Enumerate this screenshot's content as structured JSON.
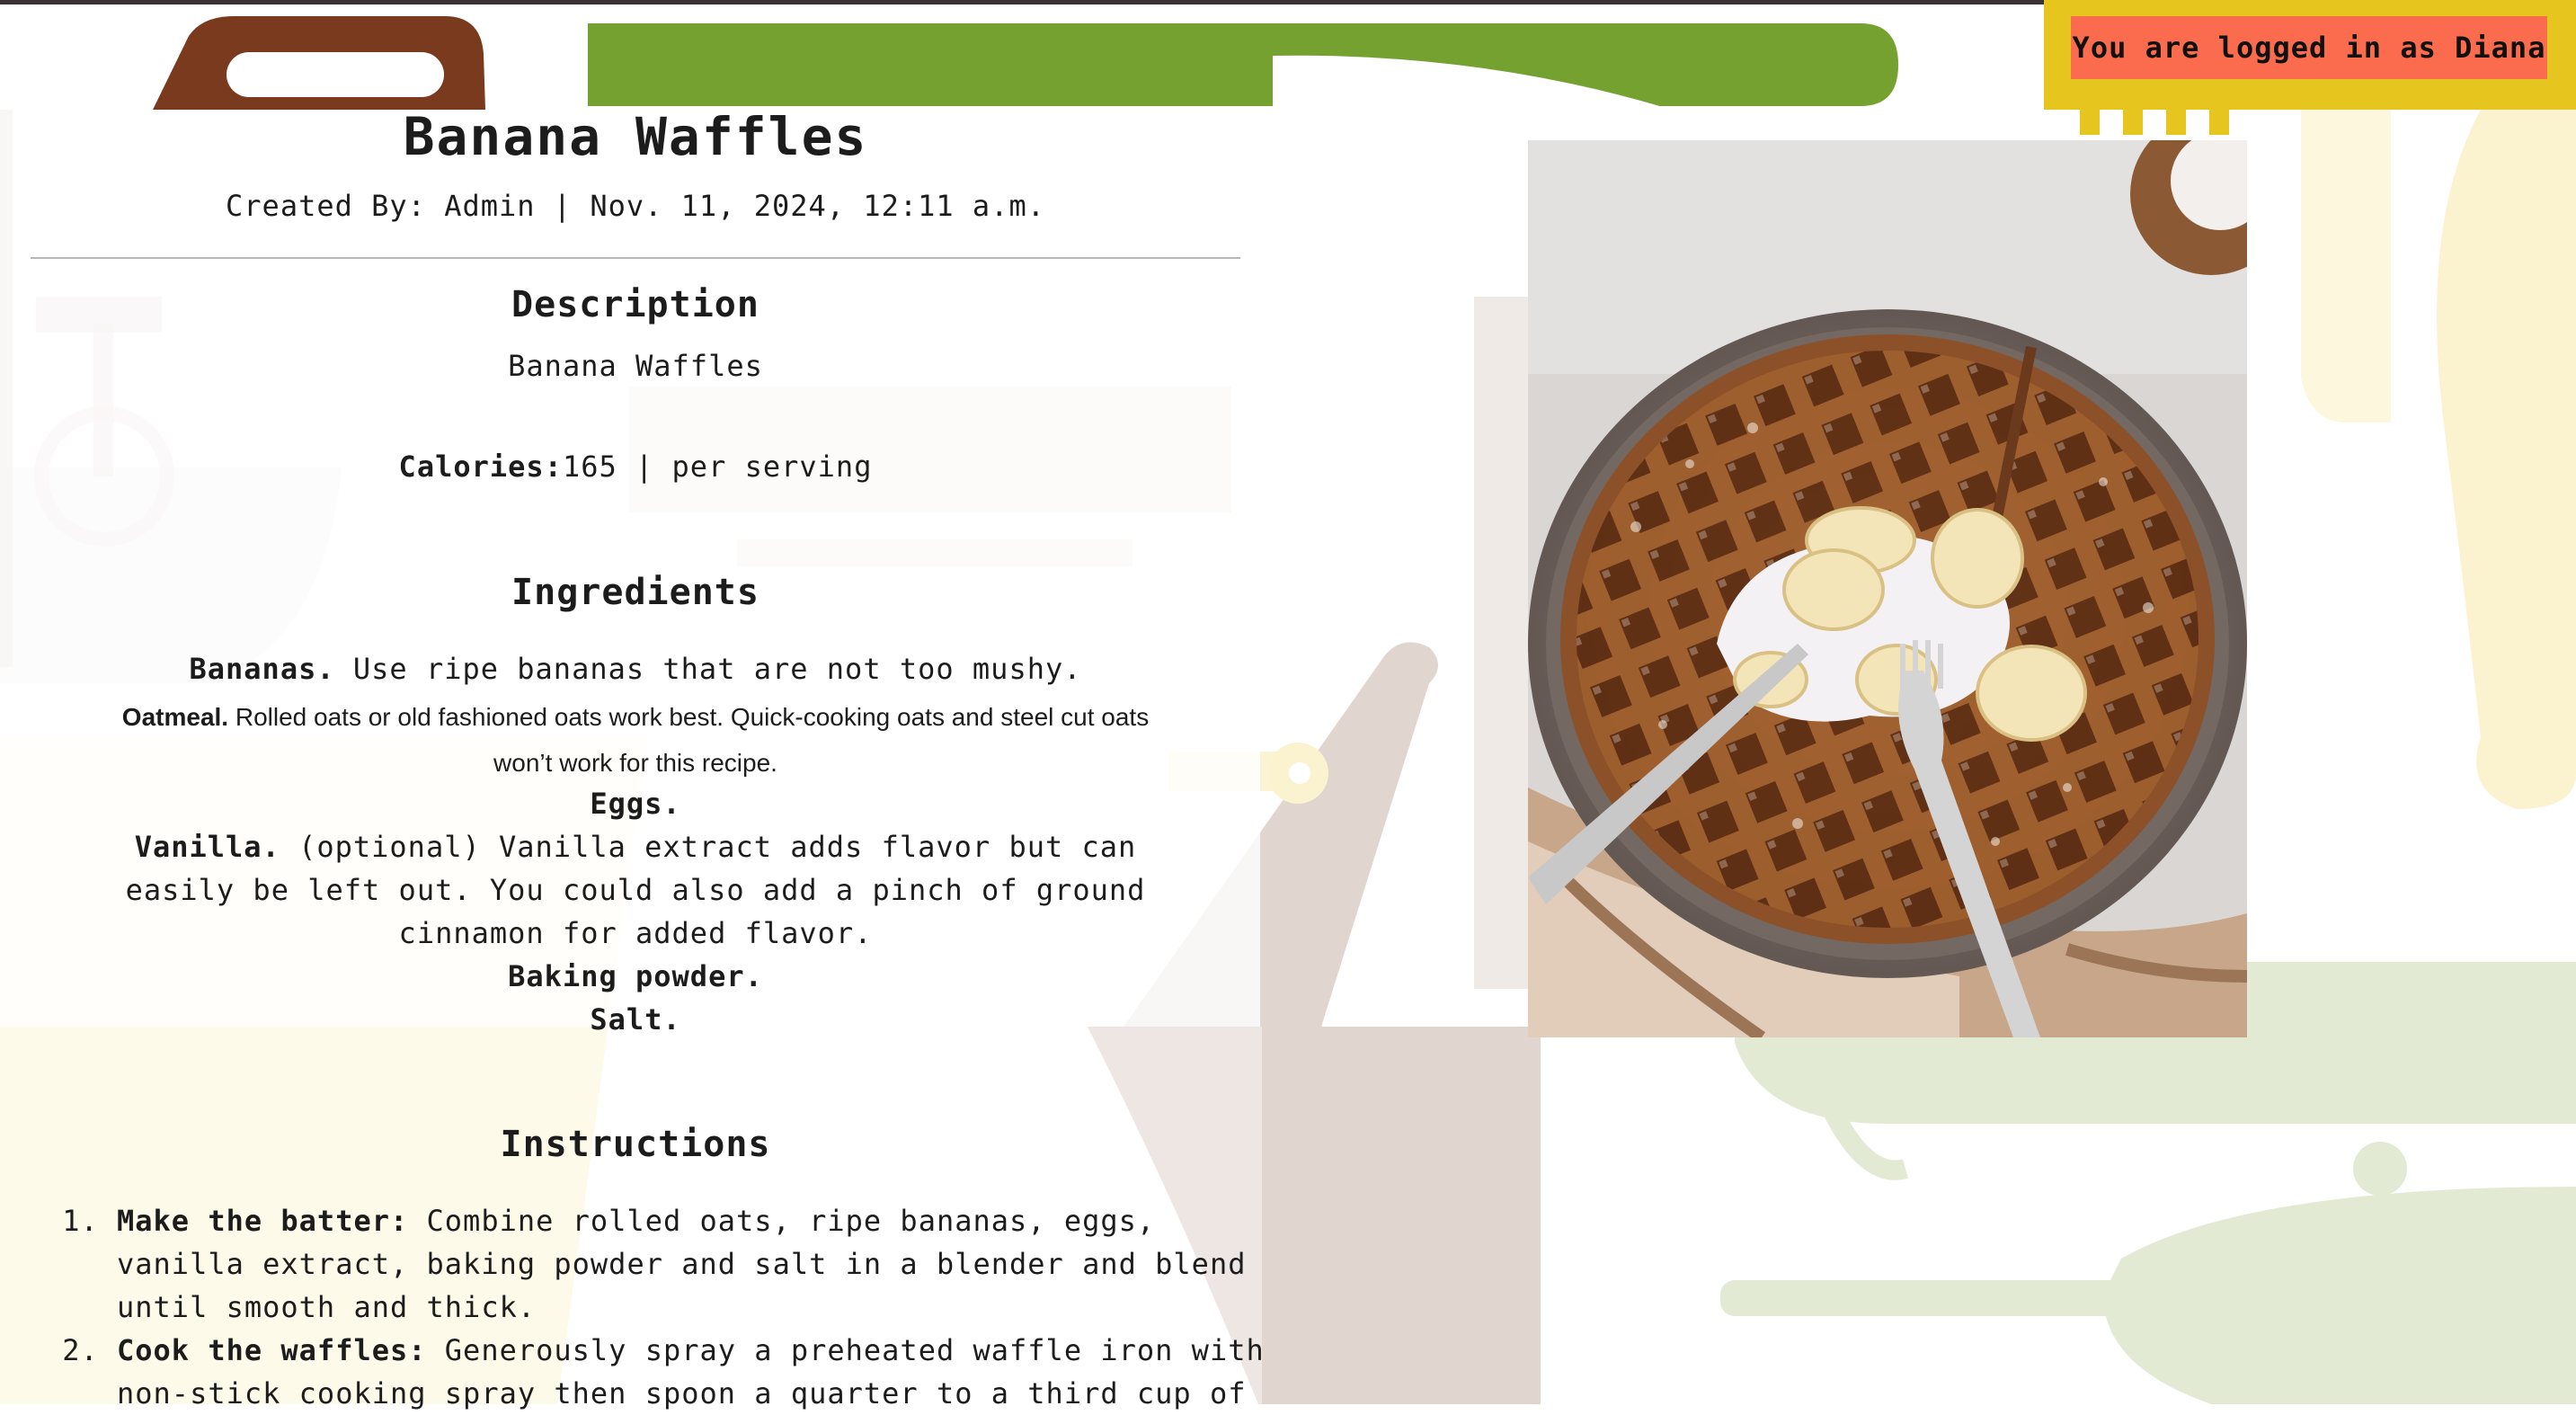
{
  "auth": {
    "logged_in_label": "You are logged in as Diana"
  },
  "recipe": {
    "title": "Banana Waffles",
    "meta": "Created By: Admin | Nov. 11, 2024, 12:11 a.m.",
    "description_heading": "Description",
    "description": "Banana Waffles",
    "calories_label": "Calories:",
    "calories_value": "165 | per serving",
    "ingredients_heading": "Ingredients",
    "ingredients": [
      {
        "name": "Bananas.",
        "text": " Use ripe bananas that are not too mushy."
      },
      {
        "name": "Oatmeal.",
        "text": " Rolled oats or old fashioned oats work best. Quick-cooking oats and steel cut oats won’t work for this recipe."
      },
      {
        "name": "Eggs.",
        "text": ""
      },
      {
        "name": "Vanilla.",
        "text": " (optional) Vanilla extract adds flavor but can easily be left out. You could also add a pinch of ground cinnamon for added flavor."
      },
      {
        "name": "Baking powder.",
        "text": ""
      },
      {
        "name": "Salt.",
        "text": ""
      }
    ],
    "instructions_heading": "Instructions",
    "instructions": [
      {
        "name": "Make the batter:",
        "text": " Combine rolled oats, ripe bananas, eggs, vanilla extract, baking powder and salt in a blender and blend until smooth and thick."
      },
      {
        "name": "Cook the waffles:",
        "text": " Generously spray a preheated waffle iron with non-stick cooking spray then spoon a quarter to a third cup of"
      }
    ]
  },
  "colors": {
    "accent_badge": "#fb6b4e",
    "bg_brown": "#7a3a1e",
    "bg_green": "#75a130",
    "bg_yellow": "#e6c51f",
    "bg_beige": "#e1d5d0",
    "bg_pale_yellow": "#fbf3cf",
    "bg_pale_green": "#e3ead4"
  },
  "icons": {
    "background": "kitchen-utensils-pattern",
    "photo": "banana-waffle-photo"
  }
}
